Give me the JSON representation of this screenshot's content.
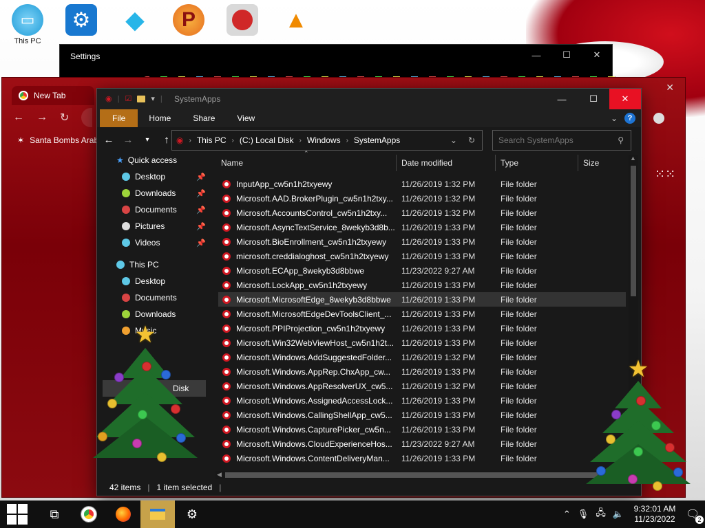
{
  "desktop": {
    "icons": [
      {
        "label": "This PC",
        "icon": "monitor-icon",
        "color": "#1f9cd8"
      },
      {
        "label": "",
        "icon": "gear-icon",
        "color": "#1878d0"
      },
      {
        "label": "",
        "icon": "diamond-icon",
        "color": "#27b5e8"
      },
      {
        "label": "",
        "icon": "game-p-icon",
        "color": "#e66b1e"
      },
      {
        "label": "",
        "icon": "angry-bird-icon",
        "color": "#d02828"
      },
      {
        "label": "",
        "icon": "vlc-cone-icon",
        "color": "#f08a00"
      }
    ]
  },
  "settings_window": {
    "title": "Settings",
    "minimize": "—",
    "maximize": "☐",
    "close": "✕"
  },
  "chrome_window": {
    "tab_title": "New Tab",
    "bookmark": "Santa Bombs Arab",
    "close": "✕"
  },
  "explorer": {
    "title": "SystemApps",
    "ribbon_tabs": [
      "File",
      "Home",
      "Share",
      "View"
    ],
    "breadcrumb": [
      "This PC",
      "(C:) Local Disk",
      "Windows",
      "SystemApps"
    ],
    "search_placeholder": "Search SystemApps",
    "controls": {
      "minimize": "—",
      "maximize": "☐",
      "close": "✕"
    },
    "nav_pane": {
      "quick_access": "Quick access",
      "quick_items": [
        "Desktop",
        "Downloads",
        "Documents",
        "Pictures",
        "Videos"
      ],
      "this_pc": "This PC",
      "pc_items": [
        "Desktop",
        "Documents",
        "Downloads",
        "Music"
      ],
      "disk_item": "Disk"
    },
    "columns": {
      "name": "Name",
      "date": "Date modified",
      "type": "Type",
      "size": "Size"
    },
    "files": [
      {
        "name": "InputApp_cw5n1h2txyewy",
        "date": "11/26/2019 1:32 PM",
        "type": "File folder"
      },
      {
        "name": "Microsoft.AAD.BrokerPlugin_cw5n1h2txy...",
        "date": "11/26/2019 1:32 PM",
        "type": "File folder"
      },
      {
        "name": "Microsoft.AccountsControl_cw5n1h2txy...",
        "date": "11/26/2019 1:32 PM",
        "type": "File folder"
      },
      {
        "name": "Microsoft.AsyncTextService_8wekyb3d8b...",
        "date": "11/26/2019 1:33 PM",
        "type": "File folder"
      },
      {
        "name": "Microsoft.BioEnrollment_cw5n1h2txyewy",
        "date": "11/26/2019 1:33 PM",
        "type": "File folder"
      },
      {
        "name": "microsoft.creddialoghost_cw5n1h2txyewy",
        "date": "11/26/2019 1:33 PM",
        "type": "File folder"
      },
      {
        "name": "Microsoft.ECApp_8wekyb3d8bbwe",
        "date": "11/23/2022 9:27 AM",
        "type": "File folder"
      },
      {
        "name": "Microsoft.LockApp_cw5n1h2txyewy",
        "date": "11/26/2019 1:33 PM",
        "type": "File folder"
      },
      {
        "name": "Microsoft.MicrosoftEdge_8wekyb3d8bbwe",
        "date": "11/26/2019 1:33 PM",
        "type": "File folder"
      },
      {
        "name": "Microsoft.MicrosoftEdgeDevToolsClient_...",
        "date": "11/26/2019 1:33 PM",
        "type": "File folder"
      },
      {
        "name": "Microsoft.PPIProjection_cw5n1h2txyewy",
        "date": "11/26/2019 1:33 PM",
        "type": "File folder"
      },
      {
        "name": "Microsoft.Win32WebViewHost_cw5n1h2t...",
        "date": "11/26/2019 1:33 PM",
        "type": "File folder"
      },
      {
        "name": "Microsoft.Windows.AddSuggestedFolder...",
        "date": "11/26/2019 1:32 PM",
        "type": "File folder"
      },
      {
        "name": "Microsoft.Windows.AppRep.ChxApp_cw...",
        "date": "11/26/2019 1:33 PM",
        "type": "File folder"
      },
      {
        "name": "Microsoft.Windows.AppResolverUX_cw5...",
        "date": "11/26/2019 1:32 PM",
        "type": "File folder"
      },
      {
        "name": "Microsoft.Windows.AssignedAccessLock...",
        "date": "11/26/2019 1:33 PM",
        "type": "File folder"
      },
      {
        "name": "Microsoft.Windows.CallingShellApp_cw5...",
        "date": "11/26/2019 1:33 PM",
        "type": "File folder"
      },
      {
        "name": "Microsoft.Windows.CapturePicker_cw5n...",
        "date": "11/26/2019 1:33 PM",
        "type": "File folder"
      },
      {
        "name": "Microsoft.Windows.CloudExperienceHos...",
        "date": "11/23/2022 9:27 AM",
        "type": "File folder"
      },
      {
        "name": "Microsoft.Windows.ContentDeliveryMan...",
        "date": "11/26/2019 1:33 PM",
        "type": "File folder"
      }
    ],
    "selected_index": 8,
    "status": {
      "items": "42 items",
      "selected": "1 item selected"
    }
  },
  "taskbar": {
    "clock_time": "9:32:01 AM",
    "clock_date": "11/23/2022",
    "notification_count": "2",
    "active_app": "file-explorer"
  },
  "colors": {
    "accent_file_tab": "#b46e17",
    "close_red": "#e81123",
    "chrome_theme": "#8c0a10",
    "taskbar_active": "#c7a24a"
  }
}
